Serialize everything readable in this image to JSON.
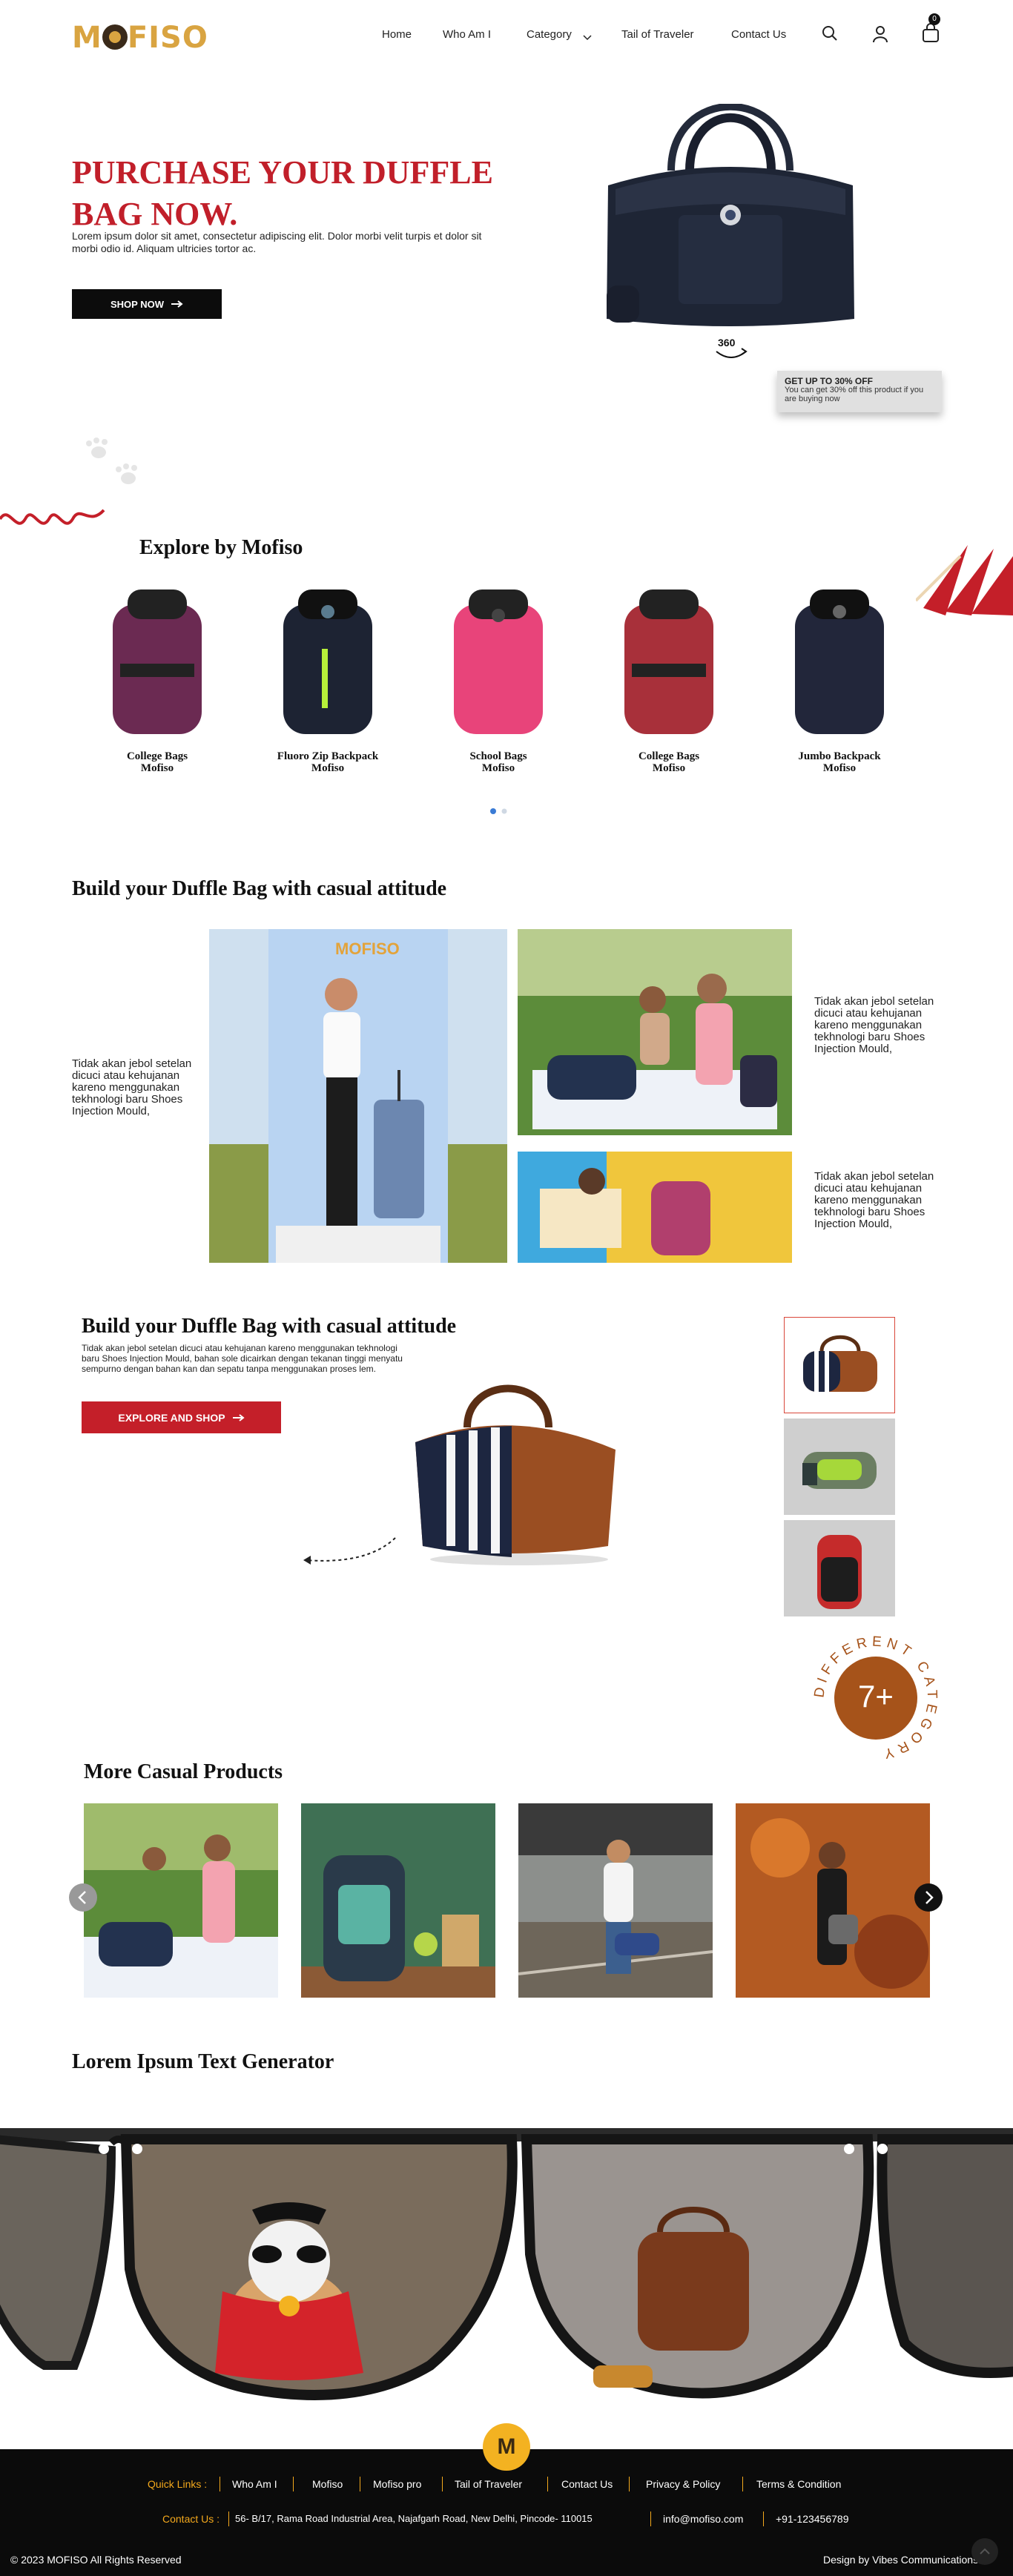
{
  "header": {
    "logo": "MOFISO",
    "nav": [
      "Home",
      "Who Am I",
      "Category",
      "Tail of Traveler",
      "Contact Us"
    ],
    "cart_count": "0"
  },
  "hero": {
    "title": "PURCHASE YOUR DUFFLE BAG NOW.",
    "description": "Lorem ipsum dolor sit amet, consectetur adipiscing elit. Dolor morbi velit turpis et dolor sit morbi odio id. Aliquam ultricies tortor ac.",
    "button": "SHOP NOW",
    "view_label": "360",
    "promo_title": "GET UP TO 30% OFF",
    "promo_text": "You can get 30% off this product if you are buying now"
  },
  "explore": {
    "title": "Explore by  Mofiso",
    "products": [
      {
        "name": "College Bags",
        "brand": "Mofiso",
        "color": "#6b2a52"
      },
      {
        "name": "Fluoro Zip Backpack",
        "brand": "Mofiso",
        "color": "#1d2333"
      },
      {
        "name": "School Bags",
        "brand": "Mofiso",
        "color": "#e8447a"
      },
      {
        "name": "College Bags",
        "brand": "Mofiso",
        "color": "#a8303a"
      },
      {
        "name": "Jumbo Backpack",
        "brand": "Mofiso",
        "color": "#22263a"
      }
    ]
  },
  "build": {
    "title": "Build your Duffle Bag with casual attitude",
    "left_text": "Tidak akan jebol setelan dicuci atau kehujanan kareno menggunakan tekhnologi baru Shoes Injection Mould,",
    "right_text_1": "Tidak akan jebol setelan dicuci atau kehujanan kareno menggunakan tekhnologi baru Shoes Injection Mould,",
    "right_text_2": "Tidak akan jebol setelan dicuci atau kehujanan kareno menggunakan tekhnologi baru Shoes Injection Mould,"
  },
  "feature": {
    "title": "Build your Duffle Bag with casual attitude",
    "text": "Tidak akan jebol setelan dicuci atau kehujanan kareno menggunakan tekhnologi baru Shoes Injection Mould, bahan sole dicairkan dengan tekanan tinggi menyatu sempurno dengan bahan kan dan sepatu tanpa menggunakan proses lem.",
    "button": "EXPLORE AND SHOP",
    "badge_number": "7+",
    "badge_text": "DIFFERENT CATEGORY"
  },
  "more": {
    "title": "More Casual Products"
  },
  "lorem": {
    "title": "Lorem Ipsum Text Generator"
  },
  "footer": {
    "quick_links_label": "Quick Links :",
    "links": [
      "Who Am I",
      "Mofiso",
      "Mofiso pro",
      "Tail of Traveler",
      "Contact Us",
      "Privacy & Policy",
      "Terms & Condition"
    ],
    "contact_label": "Contact Us :",
    "address": "56- B/17, Rama Road Industrial Area, Najafgarh Road, New Delhi, Pincode- 110015",
    "email": "info@mofiso.com",
    "phone": "+91-123456789",
    "copyright": "© 2023 MOFISO All Rights Reserved",
    "credit": "Design by Vibes Communications"
  }
}
